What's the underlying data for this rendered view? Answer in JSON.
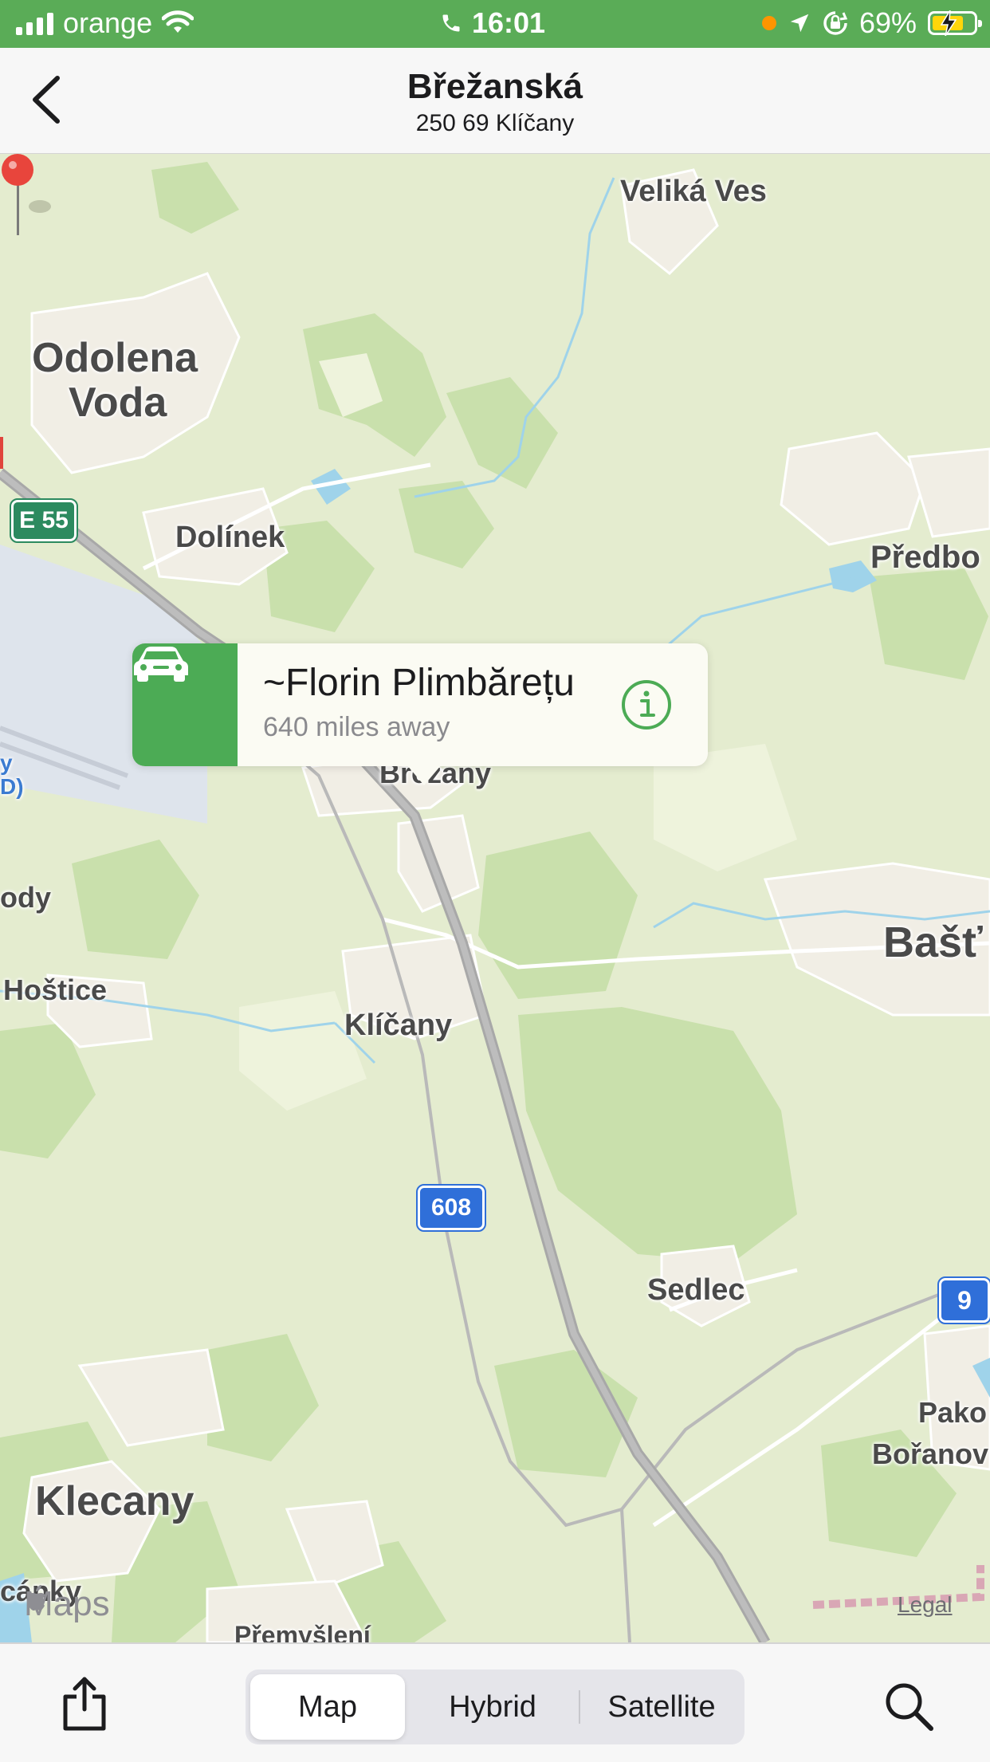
{
  "status_bar": {
    "carrier": "orange",
    "time": "16:01",
    "battery": "69%",
    "signal_icon": "signal-bars-icon",
    "wifi_icon": "wifi-icon",
    "call_icon": "phone-icon",
    "location_icon": "location-arrow-icon",
    "lock_icon": "orientation-lock-icon",
    "background_color": "#5aac57"
  },
  "nav": {
    "title": "Břežanská",
    "subtitle": "250 69 Klíčany",
    "back_icon": "chevron-left-icon"
  },
  "map": {
    "labels": {
      "velika_ves": "Veliká Ves",
      "odolena_voda_1": "Odolena",
      "odolena_voda_2": "Voda",
      "dolinek": "Dolínek",
      "predboj": "Předbo",
      "e55": "E 55",
      "brezany": "Břežany",
      "hostice": "Hoštice",
      "ody": "ody",
      "klicany": "Klíčany",
      "bast": "Bašť",
      "road_608": "608",
      "sedlec": "Sedlec",
      "road_9": "9",
      "pako": "Pako",
      "boranov": "Bořanov",
      "klecany": "Klecany",
      "canky": "cánky",
      "premysleni": "Přemyšlení",
      "airport_y": "y",
      "airport_d": "D)"
    },
    "callout": {
      "name": "~Florin Plimbărețu",
      "distance": "640 miles away",
      "car_icon": "car-icon",
      "info_icon": "info-icon",
      "accent_color": "#4cab55"
    },
    "pin_color": "#e8453c",
    "maps_logo": "Maps",
    "legal": "Legal"
  },
  "toolbar": {
    "share_icon": "share-icon",
    "search_icon": "search-icon",
    "map_types": [
      "Map",
      "Hybrid",
      "Satellite"
    ],
    "selected": "Map"
  }
}
